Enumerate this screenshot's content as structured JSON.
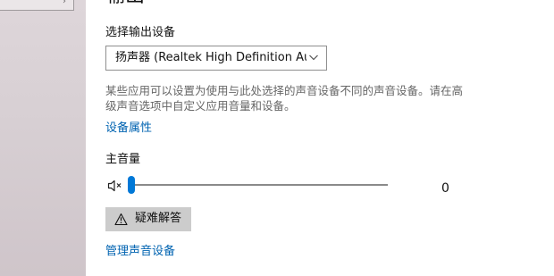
{
  "output": {
    "heading": "输出",
    "device_label": "选择输出设备",
    "selected_device": "扬声器 (Realtek High Definition Audi...",
    "description": "某些应用可以设置为使用与此处选择的声音设备不同的声音设备。请在高级声音选项中自定义应用音量和设备。",
    "device_properties_link": "设备属性",
    "master_volume_label": "主音量",
    "volume": 0,
    "volume_display": "0",
    "troubleshoot_label": "疑难解答",
    "manage_devices_link": "管理声音设备"
  },
  "icons": {
    "chevron": "chevron-down-icon",
    "mute": "speaker-muted-icon",
    "warning": "warning-icon"
  },
  "colors": {
    "accent": "#0078d7",
    "link": "#0063b1",
    "button_background": "#cccccc",
    "left_pane": "#d8d0d4"
  }
}
